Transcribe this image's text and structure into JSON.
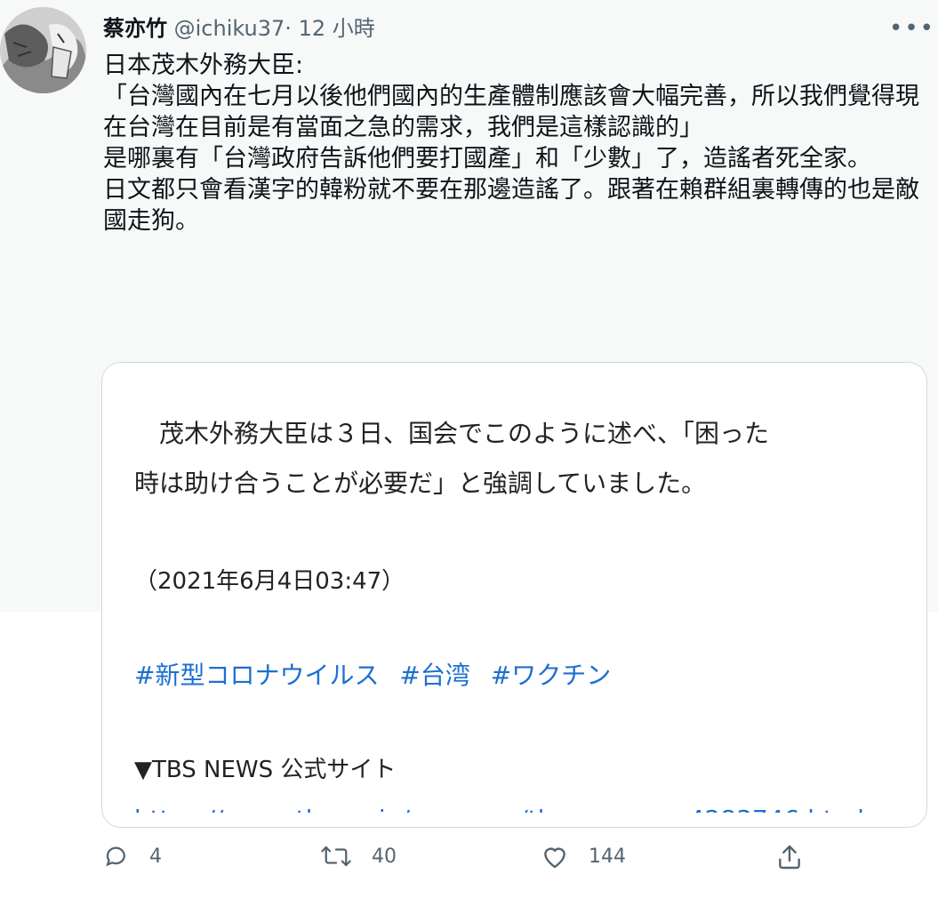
{
  "tweet": {
    "author_name": "蔡亦竹",
    "handle": "@ichiku37",
    "separator": "·",
    "time": "12 小時",
    "more_icon": "more-horizontal-icon",
    "text_lines": [
      "日本茂木外務大臣:",
      "「台灣國內在七月以後他們國內的生產體制應該會大幅完善，所以我們覺得現在台灣在目前是有當面之急的需求，我們是這樣認識的」",
      "是哪裏有「台灣政府告訴他們要打國產」和「少數」了，造謠者死全家。",
      "日文都只會看漢字的韓粉就不要在那邊造謠了。跟著在賴群組裏轉傳的也是敵國走狗。"
    ]
  },
  "card": {
    "line1": "　茂木外務大臣は３日、国会でこのように述べ、「困った",
    "line2": "時は助け合うことが必要だ」と強調していました。",
    "date": "（2021年6月4日03:47）",
    "hashtags": [
      "#新型コロナウイルス",
      "#台湾",
      "#ワクチン"
    ],
    "site": "▼TBS NEWS 公式サイト",
    "link_cut": "https://news.tbs.co.jp/newseye/tbs_newseye4283746.html"
  },
  "actions": {
    "reply_count": "4",
    "retweet_count": "40",
    "like_count": "144"
  },
  "colors": {
    "background_top": "#f7f9f9",
    "link": "#1c6fd1",
    "muted": "#536471"
  }
}
